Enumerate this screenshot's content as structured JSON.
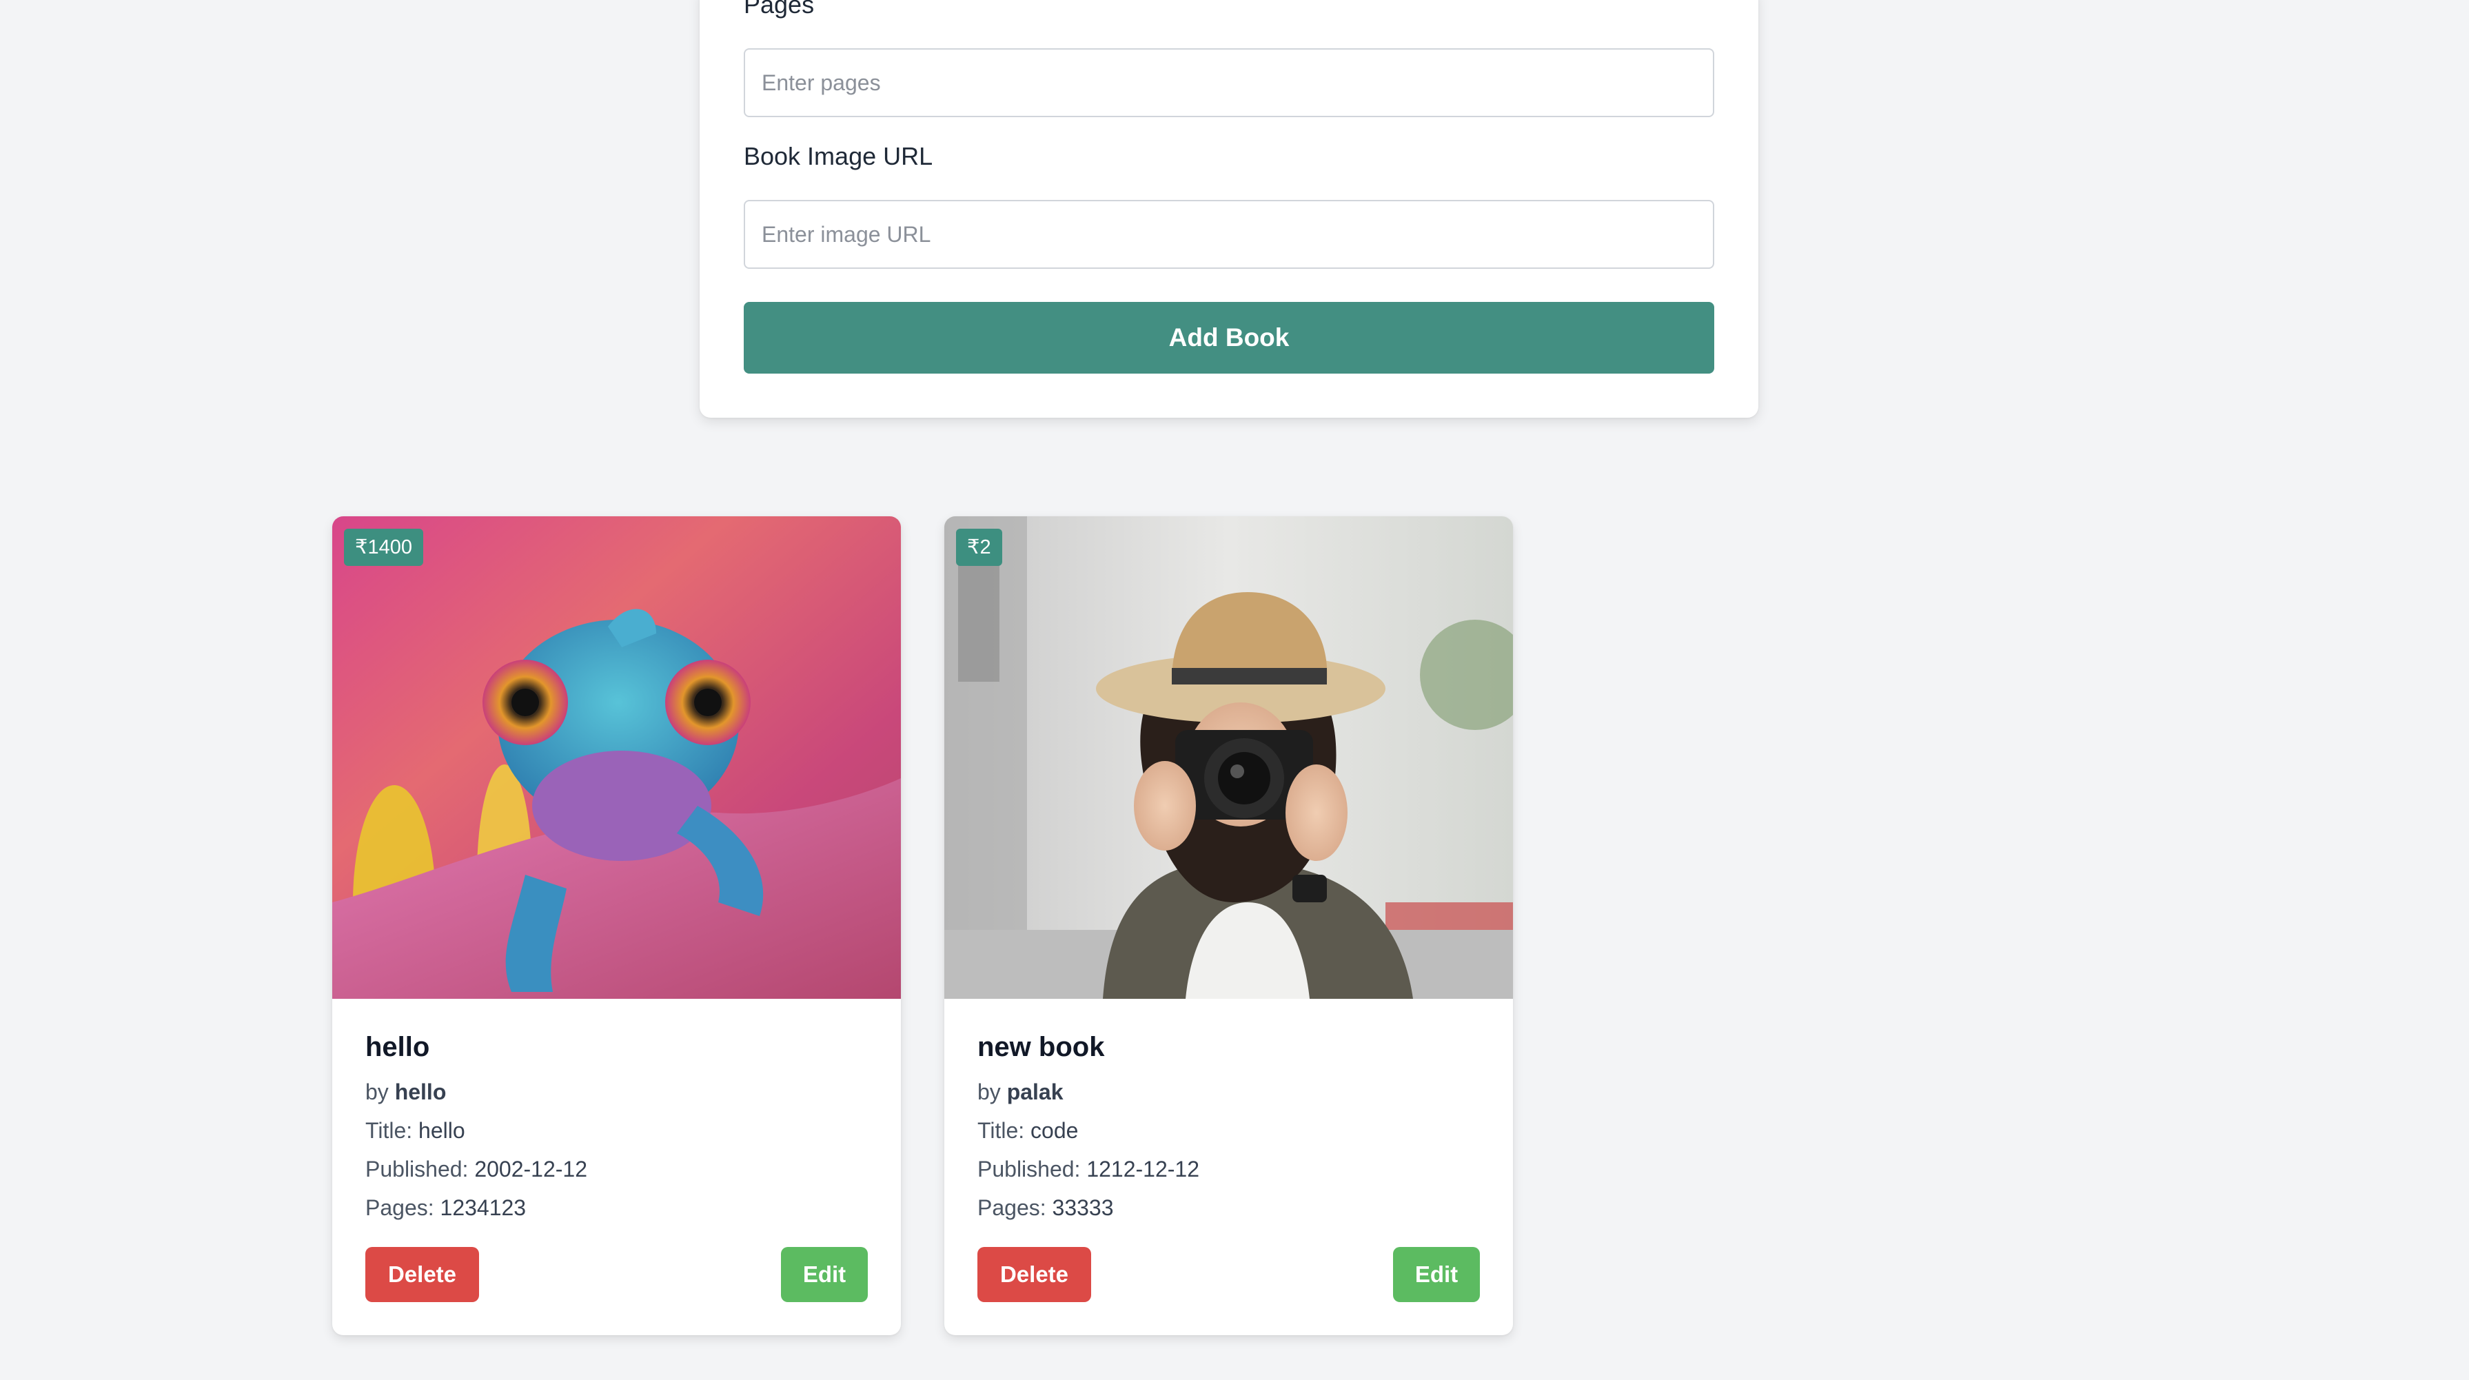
{
  "form": {
    "pages_label": "Pages",
    "pages_placeholder": "Enter pages",
    "image_label": "Book Image URL",
    "image_placeholder": "Enter image URL",
    "submit_label": "Add Book"
  },
  "books": [
    {
      "price": "₹1400",
      "name": "hello",
      "by_prefix": "by",
      "author": "hello",
      "title_label": "Title:",
      "title": "hello",
      "published_label": "Published:",
      "published": "2002-12-12",
      "pages_label": "Pages:",
      "pages": "1234123",
      "delete_label": "Delete",
      "edit_label": "Edit",
      "image_icon": "chameleon-photo"
    },
    {
      "price": "₹2",
      "name": "new book",
      "by_prefix": "by",
      "author": "palak",
      "title_label": "Title:",
      "title": "code",
      "published_label": "Published:",
      "published": "1212-12-12",
      "pages_label": "Pages:",
      "pages": "33333",
      "delete_label": "Delete",
      "edit_label": "Edit",
      "image_icon": "photographer-photo"
    }
  ],
  "colors": {
    "primary": "#438f82",
    "delete": "#dc4a46",
    "edit": "#5cbb61",
    "background": "#f3f4f6"
  }
}
